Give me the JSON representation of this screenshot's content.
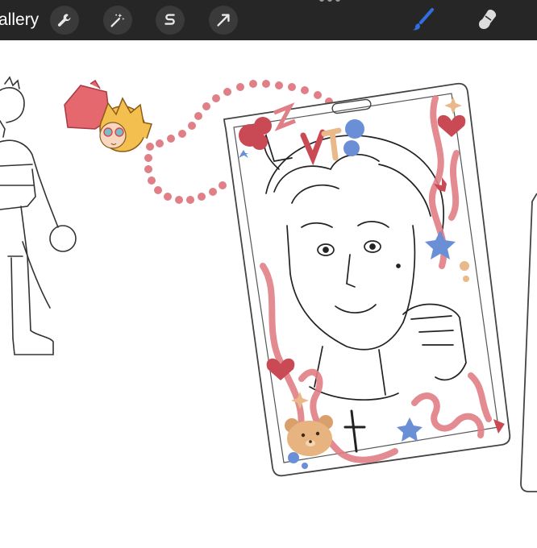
{
  "toolbar": {
    "gallery_label": "allery",
    "tools": [
      {
        "name": "wrench-icon"
      },
      {
        "name": "magic-wand-icon"
      },
      {
        "name": "selection-s-icon"
      },
      {
        "name": "transform-arrow-icon"
      }
    ],
    "brush_color": "#2f6fe0",
    "icon_color": "#e8e8e8"
  },
  "canvas": {
    "accent_pink": "#e07f86",
    "accent_red": "#c94a55",
    "accent_blue": "#6b8fd6",
    "accent_peach": "#e9b98a"
  }
}
